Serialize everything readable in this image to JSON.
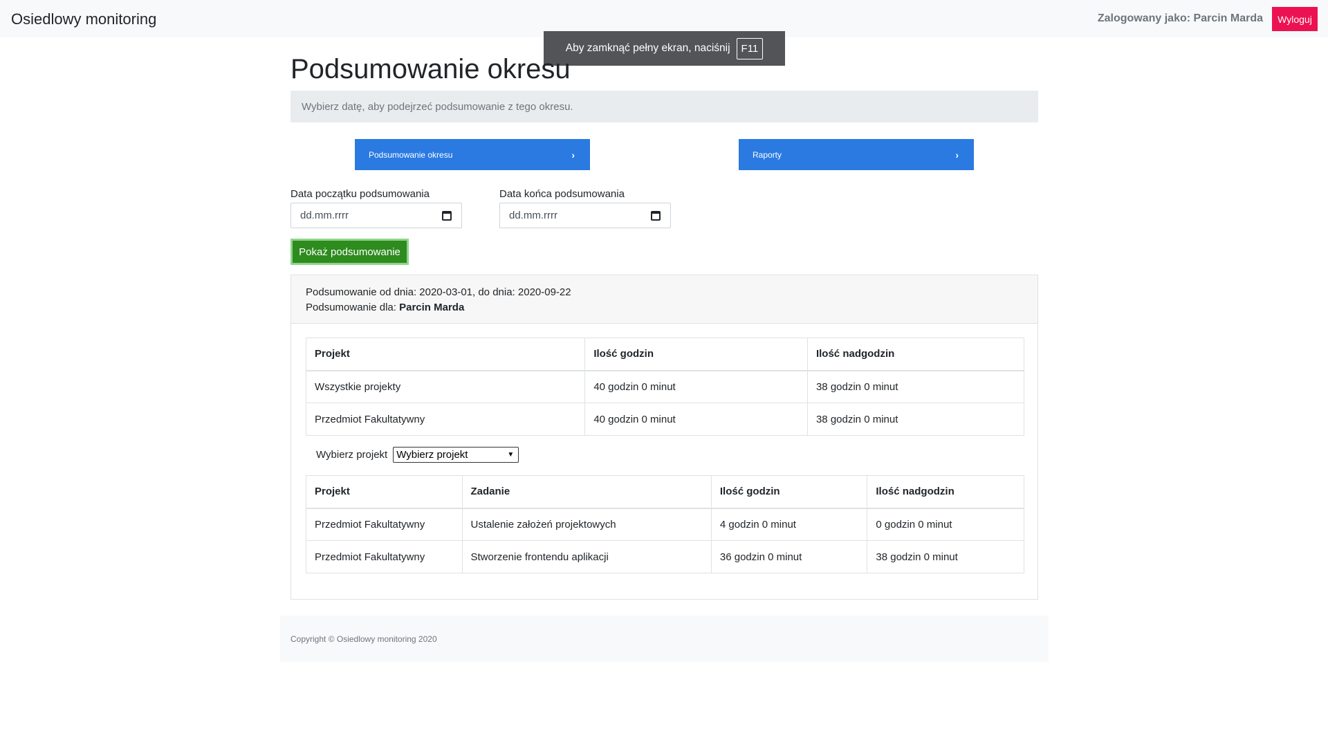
{
  "navbar": {
    "brand": "Osiedlowy monitoring",
    "user_label": "Zalogowany jako: Parcin Marda",
    "logout_label": "Wyloguj"
  },
  "fullscreen_notice": {
    "text": "Aby zamknąć pełny ekran, naciśnij",
    "key": "F11"
  },
  "page": {
    "title": "Podsumowanie okresu",
    "hint": "Wybierz datę, aby podejrzeć podsumowanie z tego okresu."
  },
  "nav_buttons": [
    {
      "label": "Podsumowanie okresu",
      "icon": "chevron-right-icon"
    },
    {
      "label": "Raporty",
      "icon": "chevron-right-icon"
    }
  ],
  "filters": {
    "start_label": "Data początku podsumowania",
    "start_placeholder": "dd.mm.rrrr",
    "end_label": "Data końca podsumowania",
    "end_placeholder": "dd.mm.rrrr",
    "submit_label": "Pokaż podsumowanie"
  },
  "summary": {
    "range_prefix": "Podsumowanie od dnia: 2020-03-01, do dnia: 2020-09-22",
    "for_prefix": "Podsumowanie dla: ",
    "for_name": "Parcin Marda"
  },
  "projects_table": {
    "headers": [
      "Projekt",
      "Ilość godzin",
      "Ilość nadgodzin"
    ],
    "rows": [
      [
        "Wszystkie projekty",
        "40 godzin 0 minut",
        "38 godzin 0 minut"
      ],
      [
        "Przedmiot Fakultatywny",
        "40 godzin 0 minut",
        "38 godzin 0 minut"
      ]
    ]
  },
  "project_select": {
    "label": "Wybierz projekt",
    "selected": "Wybierz projekt"
  },
  "tasks_table": {
    "headers": [
      "Projekt",
      "Zadanie",
      "Ilość godzin",
      "Ilość nadgodzin"
    ],
    "rows": [
      [
        "Przedmiot Fakultatywny",
        "Ustalenie założeń projektowych",
        "4 godzin 0 minut",
        "0 godzin 0 minut"
      ],
      [
        "Przedmiot Fakultatywny",
        "Stworzenie frontendu aplikacji",
        "36 godzin 0 minut",
        "38 godzin 0 minut"
      ]
    ]
  },
  "footer": {
    "text": "Copyright © Osiedlowy monitoring 2020"
  },
  "colors": {
    "primary": "#2a7ae2",
    "success": "#2e8b1e",
    "danger": "#ec1251"
  }
}
